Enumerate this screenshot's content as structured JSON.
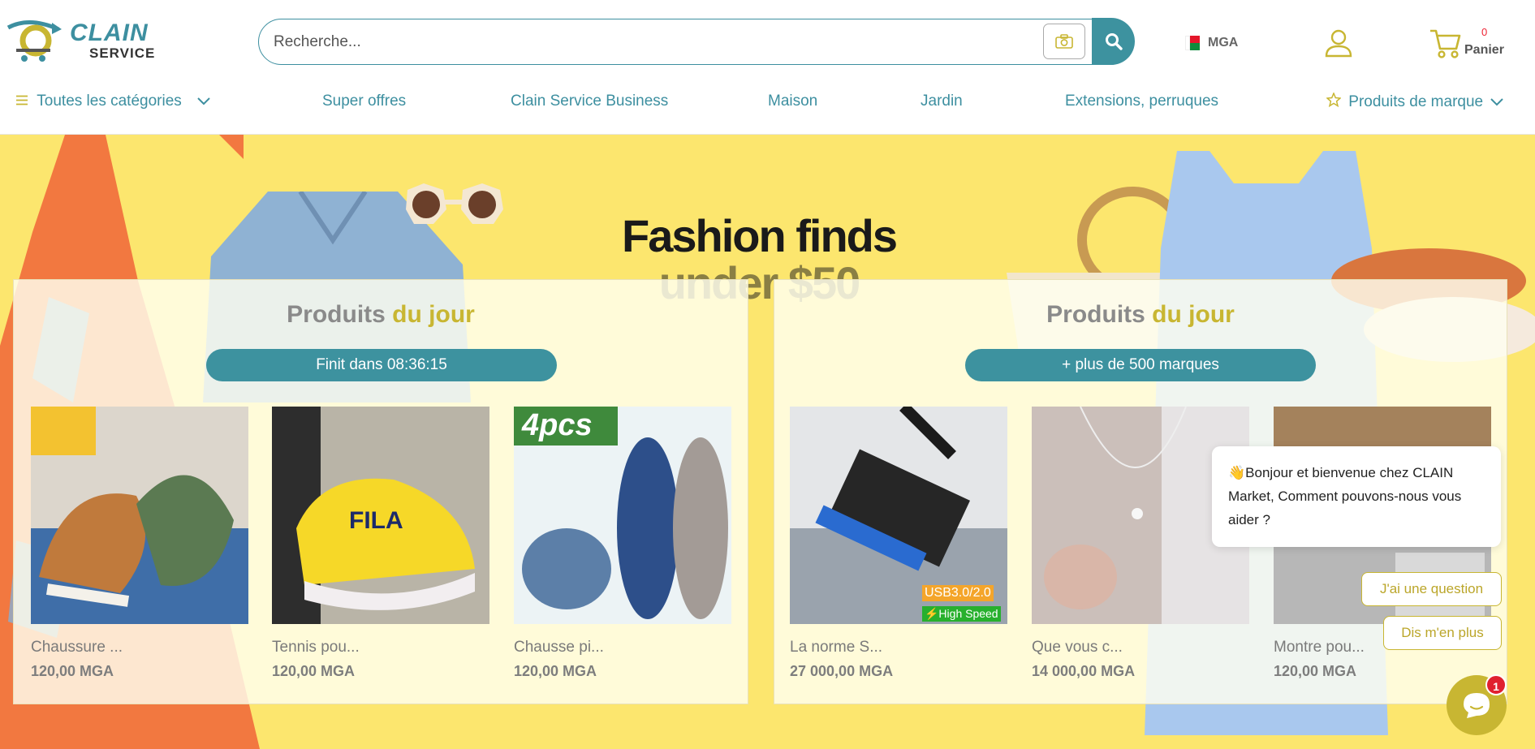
{
  "brand": {
    "name_top": "CLAIN",
    "name_bottom": "SERVICE"
  },
  "search": {
    "placeholder": "Recherche..."
  },
  "header": {
    "currency": "MGA",
    "cart": {
      "count": "0",
      "label": "Panier"
    }
  },
  "nav": {
    "items": [
      {
        "label": "Toutes les catégories"
      },
      {
        "label": "Super offres"
      },
      {
        "label": "Clain Service Business"
      },
      {
        "label": "Maison"
      },
      {
        "label": "Jardin"
      },
      {
        "label": "Extensions, perruques"
      },
      {
        "label": "Produits de marque"
      }
    ]
  },
  "hero": {
    "title_line1": "Fashion finds",
    "title_line2": "under $50"
  },
  "deals": {
    "title_main": "Produits",
    "title_accent": "du jour",
    "countdown": "Finit dans 08:36:15",
    "products": [
      {
        "name": "Chaussure ...",
        "price": "120,00 MGA"
      },
      {
        "name": "Tennis pou...",
        "price": "120,00 MGA"
      },
      {
        "name": "Chausse pi...",
        "price": "120,00 MGA"
      }
    ]
  },
  "brands": {
    "title_main": "Produits",
    "title_accent": "du jour",
    "pill": "+ plus de 500 marques",
    "products": [
      {
        "name": "La norme S...",
        "price": "27 000,00 MGA",
        "badge1": "USB3.0/2.0",
        "badge2": "⚡High Speed"
      },
      {
        "name": "Que vous c...",
        "price": "14 000,00 MGA"
      },
      {
        "name": "Montre pou...",
        "price": "120,00 MGA"
      }
    ]
  },
  "promo_badge": "4pcs",
  "chat": {
    "message": "👋Bonjour et bienvenue chez CLAIN Market, Comment pouvons-nous vous aider ?",
    "option1": "J'ai une question",
    "option2": "Dis m'en plus",
    "unread": "1"
  },
  "colors": {
    "accent": "#3d929f",
    "gold": "#c8b632",
    "hero_bg": "#fce66e"
  }
}
